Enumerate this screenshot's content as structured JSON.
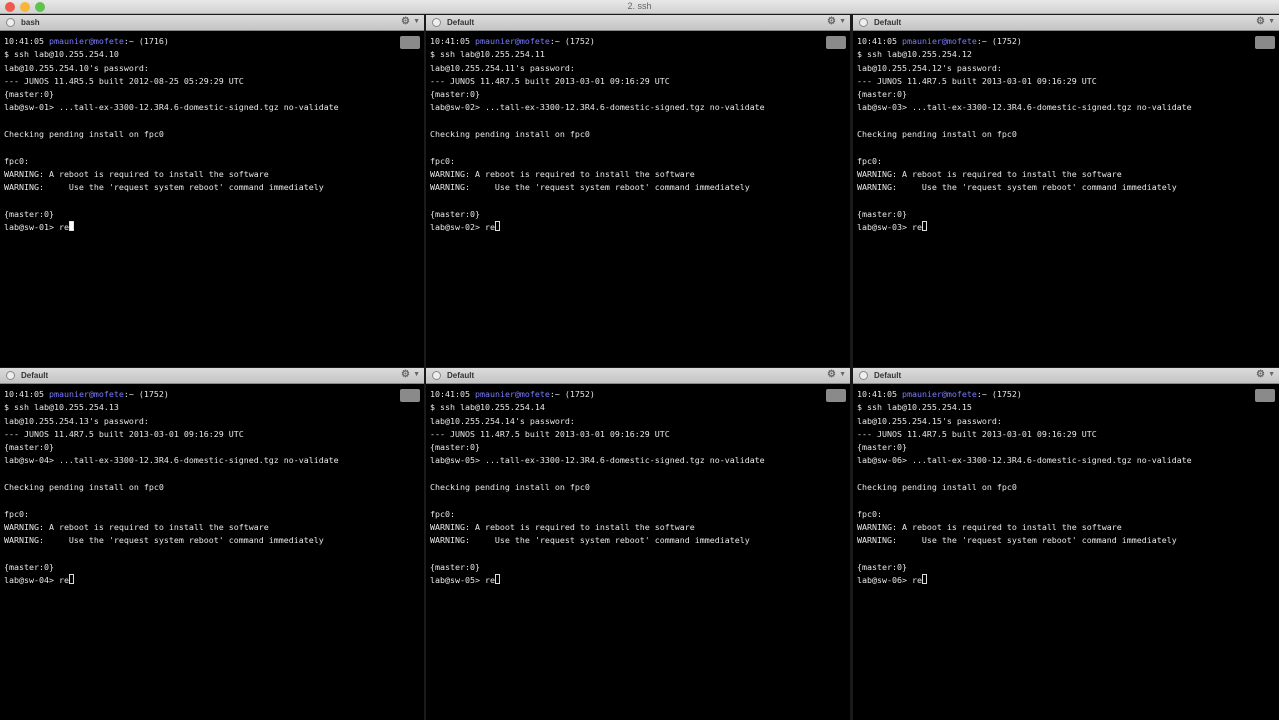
{
  "window": {
    "title": "2. ssh"
  },
  "colors": {
    "close": "#ee5a50",
    "minimize": "#f5b63a",
    "zoom": "#5fc24a",
    "user": "#7b7bff"
  },
  "panes": [
    {
      "name": "bash",
      "time": "10:41:05",
      "user": "pmaunier@mofete",
      "path": ":~",
      "pid": "(1716)",
      "cursor_active": true,
      "lines": [
        "$ ssh lab@10.255.254.10",
        "lab@10.255.254.10's password:",
        "--- JUNOS 11.4R5.5 built 2012-08-25 05:29:29 UTC",
        "{master:0}",
        "lab@sw-01> ...tall-ex-3300-12.3R4.6-domestic-signed.tgz no-validate",
        "",
        "Checking pending install on fpc0",
        "",
        "fpc0:",
        "WARNING: A reboot is required to install the software",
        "WARNING:     Use the 'request system reboot' command immediately",
        "",
        "{master:0}"
      ],
      "prompt": "lab@sw-01> re"
    },
    {
      "name": "Default",
      "time": "10:41:05",
      "user": "pmaunier@mofete",
      "path": ":~",
      "pid": "(1752)",
      "cursor_active": false,
      "lines": [
        "$ ssh lab@10.255.254.11",
        "lab@10.255.254.11's password:",
        "--- JUNOS 11.4R7.5 built 2013-03-01 09:16:29 UTC",
        "{master:0}",
        "lab@sw-02> ...tall-ex-3300-12.3R4.6-domestic-signed.tgz no-validate",
        "",
        "Checking pending install on fpc0",
        "",
        "fpc0:",
        "WARNING: A reboot is required to install the software",
        "WARNING:     Use the 'request system reboot' command immediately",
        "",
        "{master:0}"
      ],
      "prompt": "lab@sw-02> re"
    },
    {
      "name": "Default",
      "time": "10:41:05",
      "user": "pmaunier@mofete",
      "path": ":~",
      "pid": "(1752)",
      "cursor_active": false,
      "lines": [
        "$ ssh lab@10.255.254.12",
        "lab@10.255.254.12's password:",
        "--- JUNOS 11.4R7.5 built 2013-03-01 09:16:29 UTC",
        "{master:0}",
        "lab@sw-03> ...tall-ex-3300-12.3R4.6-domestic-signed.tgz no-validate",
        "",
        "Checking pending install on fpc0",
        "",
        "fpc0:",
        "WARNING: A reboot is required to install the software",
        "WARNING:     Use the 'request system reboot' command immediately",
        "",
        "{master:0}"
      ],
      "prompt": "lab@sw-03> re"
    },
    {
      "name": "Default",
      "time": "10:41:05",
      "user": "pmaunier@mofete",
      "path": ":~",
      "pid": "(1752)",
      "cursor_active": false,
      "lines": [
        "$ ssh lab@10.255.254.13",
        "lab@10.255.254.13's password:",
        "--- JUNOS 11.4R7.5 built 2013-03-01 09:16:29 UTC",
        "{master:0}",
        "lab@sw-04> ...tall-ex-3300-12.3R4.6-domestic-signed.tgz no-validate",
        "",
        "Checking pending install on fpc0",
        "",
        "fpc0:",
        "WARNING: A reboot is required to install the software",
        "WARNING:     Use the 'request system reboot' command immediately",
        "",
        "{master:0}"
      ],
      "prompt": "lab@sw-04> re"
    },
    {
      "name": "Default",
      "time": "10:41:05",
      "user": "pmaunier@mofete",
      "path": ":~",
      "pid": "(1752)",
      "cursor_active": false,
      "lines": [
        "$ ssh lab@10.255.254.14",
        "lab@10.255.254.14's password:",
        "--- JUNOS 11.4R7.5 built 2013-03-01 09:16:29 UTC",
        "{master:0}",
        "lab@sw-05> ...tall-ex-3300-12.3R4.6-domestic-signed.tgz no-validate",
        "",
        "Checking pending install on fpc0",
        "",
        "fpc0:",
        "WARNING: A reboot is required to install the software",
        "WARNING:     Use the 'request system reboot' command immediately",
        "",
        "{master:0}"
      ],
      "prompt": "lab@sw-05> re"
    },
    {
      "name": "Default",
      "time": "10:41:05",
      "user": "pmaunier@mofete",
      "path": ":~",
      "pid": "(1752)",
      "cursor_active": false,
      "lines": [
        "$ ssh lab@10.255.254.15",
        "lab@10.255.254.15's password:",
        "--- JUNOS 11.4R7.5 built 2013-03-01 09:16:29 UTC",
        "{master:0}",
        "lab@sw-06> ...tall-ex-3300-12.3R4.6-domestic-signed.tgz no-validate",
        "",
        "Checking pending install on fpc0",
        "",
        "fpc0:",
        "WARNING: A reboot is required to install the software",
        "WARNING:     Use the 'request system reboot' command immediately",
        "",
        "{master:0}"
      ],
      "prompt": "lab@sw-06> re"
    }
  ]
}
